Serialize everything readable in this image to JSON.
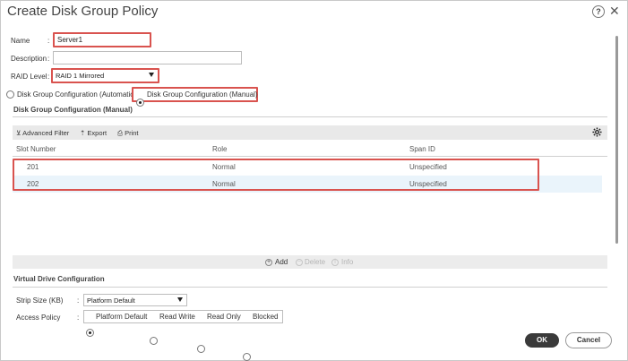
{
  "dialog": {
    "title": "Create Disk Group Policy",
    "help": "?",
    "close": "✕"
  },
  "form": {
    "name_label": "Name",
    "name_value": "Server1",
    "description_label": "Description",
    "description_value": "",
    "raid_label": "RAID Level",
    "raid_value": "RAID 1 Mirrored",
    "config_auto_label": "Disk Group Configuration (Automatic",
    "config_manual_label": "Disk Group Configuration (Manual)",
    "selected_config": "manual"
  },
  "manual_section": {
    "title": "Disk Group Configuration (Manual)",
    "toolbar": {
      "advanced_filter": "Advanced Filter",
      "export": "Export",
      "print": "Print"
    },
    "columns": [
      "Slot Number",
      "Role",
      "Span ID"
    ],
    "rows": [
      {
        "slot": "201",
        "role": "Normal",
        "span": "Unspecified"
      },
      {
        "slot": "202",
        "role": "Normal",
        "span": "Unspecified"
      }
    ],
    "actions": {
      "add": "Add",
      "delete": "Delete",
      "info": "Info"
    }
  },
  "virtual_drive": {
    "title": "Virtual Drive Configuration",
    "strip_label": "Strip Size (KB)",
    "strip_value": "Platform Default",
    "access_label": "Access Policy",
    "access_options": [
      "Platform Default",
      "Read Write",
      "Read Only",
      "Blocked"
    ],
    "access_selected": "Platform Default"
  },
  "buttons": {
    "ok": "OK",
    "cancel": "Cancel"
  },
  "colors": {
    "highlight": "#d9534f",
    "ok_button": "#3a3a3a",
    "row_highlight": "#eaf4fb"
  }
}
